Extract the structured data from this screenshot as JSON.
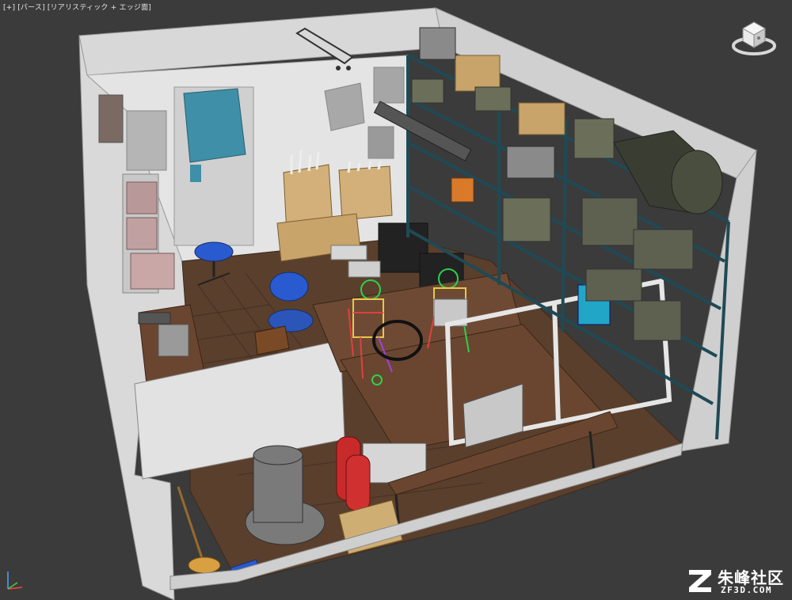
{
  "viewport": {
    "label": "[+] [パース] [リアリスティック + エッジ面]"
  },
  "icons": {
    "viewcube": "viewcube-icon",
    "axis": "axis-gizmo-icon",
    "watermark_logo": "zf-logo-icon"
  },
  "watermark": {
    "title": "朱峰社区",
    "subtitle": "ZF3D.COM"
  },
  "colors": {
    "viewport_bg": "#3b3b3b",
    "wall": "#e6e6e6",
    "floor": "#5a3e2c",
    "shelf": "#1f4a55",
    "box": "#c8a46a",
    "wire_green": "#2bd24a",
    "wire_red": "#e04040",
    "chair_blue": "#2a5ad0"
  }
}
